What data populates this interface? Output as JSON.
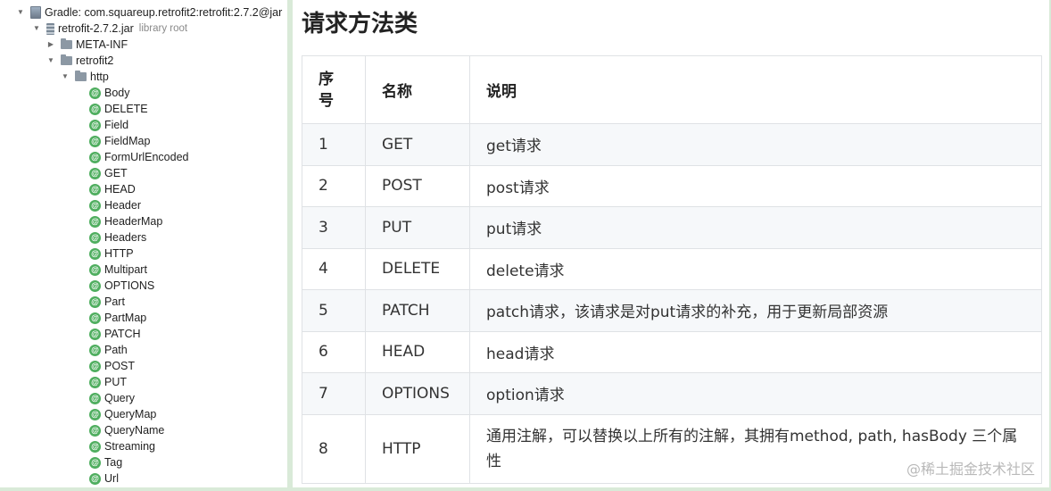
{
  "tree": {
    "root": {
      "label": "Gradle: com.squareup.retrofit2:retrofit:2.7.2@jar"
    },
    "jar": {
      "label": "retrofit-2.7.2.jar",
      "sublabel": "library root"
    },
    "meta": {
      "label": "META-INF"
    },
    "pkg": {
      "label": "retrofit2"
    },
    "http": {
      "label": "http"
    },
    "annotations": [
      "Body",
      "DELETE",
      "Field",
      "FieldMap",
      "FormUrlEncoded",
      "GET",
      "HEAD",
      "Header",
      "HeaderMap",
      "Headers",
      "HTTP",
      "Multipart",
      "OPTIONS",
      "Part",
      "PartMap",
      "PATCH",
      "Path",
      "POST",
      "PUT",
      "Query",
      "QueryMap",
      "QueryName",
      "Streaming",
      "Tag",
      "Url"
    ],
    "annotation_icon": "@"
  },
  "doc": {
    "title": "请求方法类",
    "headers": [
      "序号",
      "名称",
      "说明"
    ],
    "rows": [
      [
        "1",
        "GET",
        "get请求"
      ],
      [
        "2",
        "POST",
        "post请求"
      ],
      [
        "3",
        "PUT",
        "put请求"
      ],
      [
        "4",
        "DELETE",
        "delete请求"
      ],
      [
        "5",
        "PATCH",
        "patch请求，该请求是对put请求的补充，用于更新局部资源"
      ],
      [
        "6",
        "HEAD",
        "head请求"
      ],
      [
        "7",
        "OPTIONS",
        "option请求"
      ],
      [
        "8",
        "HTTP",
        "通用注解，可以替换以上所有的注解，其拥有method, path, hasBody 三个属性"
      ]
    ],
    "watermark": "@稀土掘金技术社区"
  },
  "colors": {
    "annotation_icon": "#4fae5f",
    "background": "#d9ead8",
    "table_stripe": "#f6f8fa"
  }
}
